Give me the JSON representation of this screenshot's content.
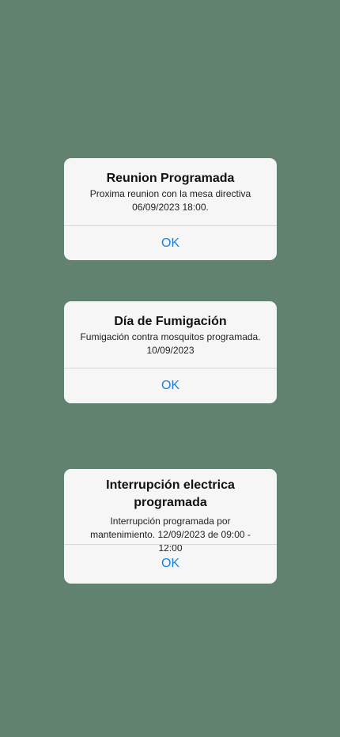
{
  "alerts": [
    {
      "title": "Reunion Programada",
      "message": "Proxima reunion con la mesa directiva 06/09/2023 18:00.",
      "button_label": "OK"
    },
    {
      "title": "Día de Fumigación",
      "message": "Fumigación contra mosquitos programada. 10/09/2023",
      "button_label": "OK"
    },
    {
      "title": "Interrupción electrica programada",
      "message": "Interrupción programada por mantenimiento. 12/09/2023 de 09:00 - 12:00",
      "button_label": "OK"
    }
  ],
  "colors": {
    "background": "#628270",
    "card": "#f6f6f6",
    "accent": "#1a80e0"
  }
}
